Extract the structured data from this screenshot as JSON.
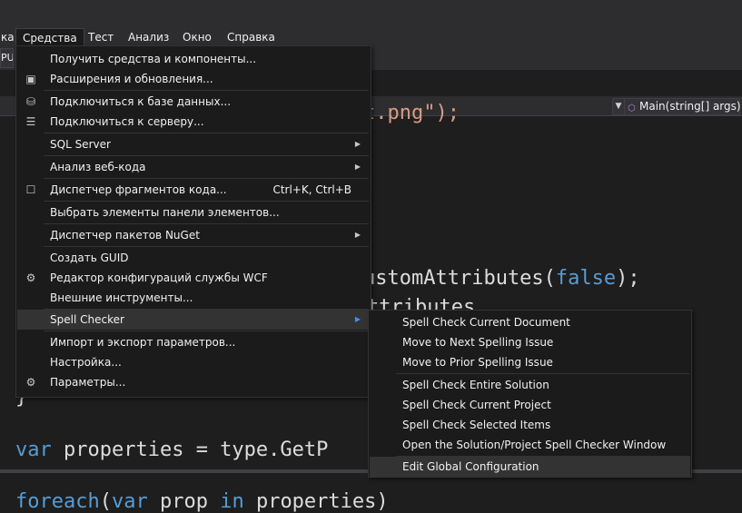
{
  "menubar": {
    "items": [
      {
        "label": "ка"
      },
      {
        "label": "Средства"
      },
      {
        "label": "Тест"
      },
      {
        "label": "Анализ"
      },
      {
        "label": "Окно"
      },
      {
        "label": "Справка"
      }
    ]
  },
  "toolbar": {
    "platform_fragment": "PU"
  },
  "navbar": {
    "method": "Main(string[] args)"
  },
  "code": {
    "line1_str": "t.png\");",
    "line2_pre": "ustomAttributes(",
    "line2_kw": "false",
    "line2_post": ");",
    "line3": "ttributes",
    "line4_brace1": "}",
    "line4_brace2": "}",
    "line5_kw": "var",
    "line5_rest": " properties = type.GetP",
    "line6_kw": "foreach",
    "line6_rest": "(",
    "line6_kw2": "var",
    "line6_rest2": " prop ",
    "line6_kw3": "in",
    "line6_rest3": " properties)"
  },
  "tools_menu": {
    "items": [
      {
        "label": "Получить средства и компоненты...",
        "icon": "none"
      },
      {
        "label": "Расширения и обновления...",
        "icon": "extensions-icon"
      },
      {
        "label": "Подключиться к базе данных...",
        "icon": "database-connect-icon"
      },
      {
        "label": "Подключиться к серверу...",
        "icon": "server-connect-icon"
      },
      {
        "label": "SQL Server",
        "submenu": true
      },
      {
        "label": "Анализ веб-кода",
        "submenu": true
      },
      {
        "label": "Диспетчер фрагментов кода...",
        "shortcut": "Ctrl+K, Ctrl+B",
        "icon": "snippet-manager-icon"
      },
      {
        "label": "Выбрать элементы панели элементов..."
      },
      {
        "label": "Диспетчер пакетов NuGet",
        "submenu": true
      },
      {
        "label": "Создать GUID"
      },
      {
        "label": "Редактор конфигураций службы WCF",
        "icon": "wcf-config-icon"
      },
      {
        "label": "Внешние инструменты..."
      },
      {
        "label": "Spell Checker",
        "submenu": true
      },
      {
        "label": "Импорт и экспорт параметров..."
      },
      {
        "label": "Настройка..."
      },
      {
        "label": "Параметры...",
        "icon": "gear-icon"
      }
    ]
  },
  "spell_submenu": {
    "items": [
      {
        "label": "Spell Check Current Document"
      },
      {
        "label": "Move to Next Spelling Issue"
      },
      {
        "label": "Move to Prior Spelling Issue"
      },
      {
        "label": "Spell Check Entire Solution"
      },
      {
        "label": "Spell Check Current Project"
      },
      {
        "label": "Spell Check Selected Items"
      },
      {
        "label": "Open the Solution/Project Spell Checker Window"
      },
      {
        "label": "Edit Global Configuration"
      }
    ]
  },
  "colors": {
    "background": "#1e1e1e",
    "menu_bg": "#1b1b1c",
    "keyword": "#569cd6",
    "string": "#d69d85",
    "highlight": "#333334"
  }
}
